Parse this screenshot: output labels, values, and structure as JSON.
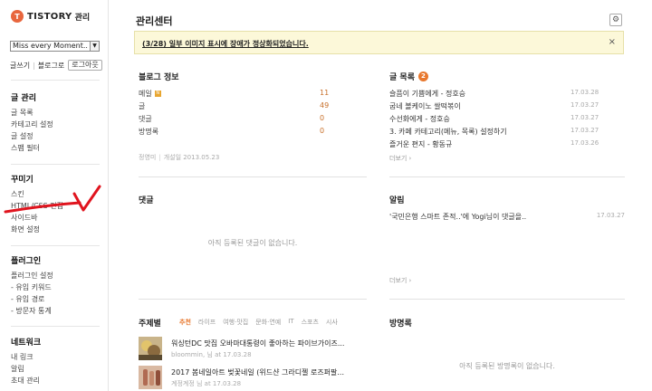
{
  "brand": {
    "logo_mark": "T",
    "name": "TISTORY",
    "suffix": "관리"
  },
  "blog_select": {
    "value": "Miss every Moment.."
  },
  "quick_links": {
    "write": "글쓰기",
    "goto_blog": "블로그로",
    "logout": "로그아웃"
  },
  "sidebar": {
    "sections": [
      {
        "title": "글 관리",
        "items": [
          "글 목록",
          "카테고리 설정",
          "글 설정",
          "스팸 필터"
        ]
      },
      {
        "title": "꾸미기",
        "items": [
          "스킨",
          "HTML/CSS 편집",
          "사이드바",
          "화면 설정"
        ]
      },
      {
        "title": "플러그인",
        "items": [
          "플러그인 설정",
          "- 유입 키워드",
          "- 유입 경로",
          "- 방문자 통계"
        ]
      },
      {
        "title": "네트워크",
        "items": [
          "내 링크",
          "알림",
          "초대 관리"
        ]
      }
    ]
  },
  "header": {
    "title": "관리센터",
    "settings_icon": "gear-icon"
  },
  "notice": {
    "message": "(3/28) 일부 이미지 표시에 장애가 정상화되었습니다.",
    "close": "×"
  },
  "blog_info": {
    "title": "블로그 정보",
    "stats": [
      {
        "label": "메일",
        "value": "11",
        "new": true
      },
      {
        "label": "글",
        "value": "49",
        "new": false
      },
      {
        "label": "댓글",
        "value": "0",
        "new": false
      },
      {
        "label": "방명록",
        "value": "0",
        "new": false
      }
    ],
    "owner": "정영미",
    "opened": "개설일 2013.05.23"
  },
  "post_list": {
    "title": "글 목록",
    "count": "2",
    "posts": [
      {
        "title": "슬픔이 기쁨에게 - 정호승",
        "date": "17.03.28"
      },
      {
        "title": "굽네 볼케이노 쌀떡볶이",
        "date": "17.03.27"
      },
      {
        "title": "수선화에게 - 정호승",
        "date": "17.03.27"
      },
      {
        "title": "3. 카페 카테고리(메뉴, 목록) 설정하기",
        "date": "17.03.27"
      },
      {
        "title": "즐거운 편지 - 황동규",
        "date": "17.03.26"
      }
    ],
    "more": "더보기 ›"
  },
  "comments": {
    "title": "댓글",
    "empty": "아직 등록된 댓글이 없습니다."
  },
  "alarm": {
    "title": "알림",
    "items": [
      {
        "text": "'국민은행 스마트 존적..'에 Yogi님이 댓글을..",
        "date": "17.03.27"
      }
    ],
    "more": "더보기 ›"
  },
  "topics": {
    "title": "주제별",
    "tabs": [
      "추천",
      "라이프",
      "여행·맛집",
      "문화·연예",
      "IT",
      "스포츠",
      "시사"
    ],
    "active": 0,
    "feed": [
      {
        "title": "워싱턴DC 맛집 오바마대통령이 좋아하는 파이브가이즈...",
        "meta": "bloommin, 님 at 17.03.28"
      },
      {
        "title": "2017 봄네일아트 벚꽃네일 (위드샨 그라디젤 로즈퍼팔...",
        "meta": "계정계정 님 at 17.03.28"
      }
    ]
  },
  "guestbook": {
    "title": "방명록",
    "empty": "아직 등록된 방명록이 없습니다."
  },
  "colors": {
    "accent": "#e8782e",
    "notice_bg": "#fcf8d9",
    "annotation": "#e0141e"
  }
}
